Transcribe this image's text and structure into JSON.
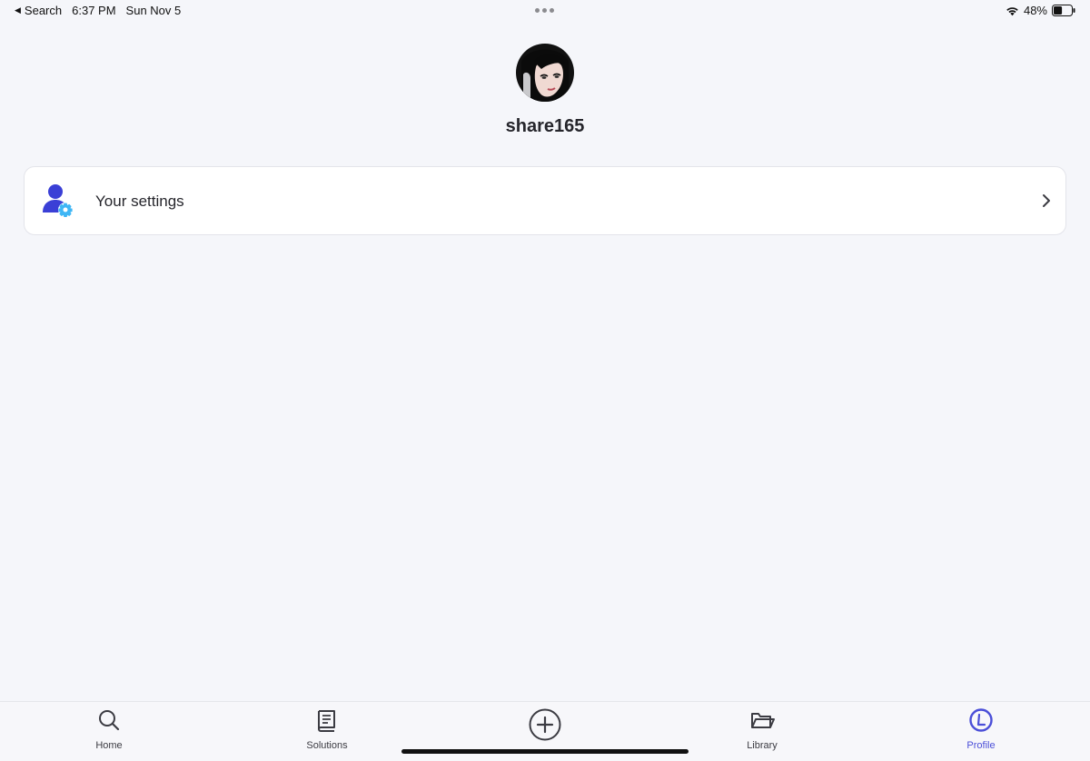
{
  "status_bar": {
    "back_label": "Search",
    "time": "6:37 PM",
    "date": "Sun Nov 5",
    "battery_percent": "48%",
    "battery_level": 0.48,
    "icons": [
      "back-arrow-icon",
      "wifi-icon",
      "battery-icon"
    ]
  },
  "profile": {
    "username": "share165",
    "avatar_icon": "avatar-illustration"
  },
  "settings_row": {
    "label": "Your settings",
    "icon": "user-settings-icon",
    "chevron_icon": "chevron-right-icon"
  },
  "tab_bar": {
    "tabs": [
      {
        "label": "Home",
        "icon": "search-icon",
        "active": false
      },
      {
        "label": "Solutions",
        "icon": "book-icon",
        "active": false
      },
      {
        "label": "Library",
        "icon": "folder-icon",
        "active": false
      },
      {
        "label": "Profile",
        "icon": "profile-icon",
        "active": true
      }
    ],
    "add_icon": "plus-circle-icon"
  },
  "colors": {
    "background": "#f5f6fa",
    "accent": "#4b4fd8",
    "settings_person": "#3a3fd6",
    "settings_gear": "#3fb6f5"
  }
}
